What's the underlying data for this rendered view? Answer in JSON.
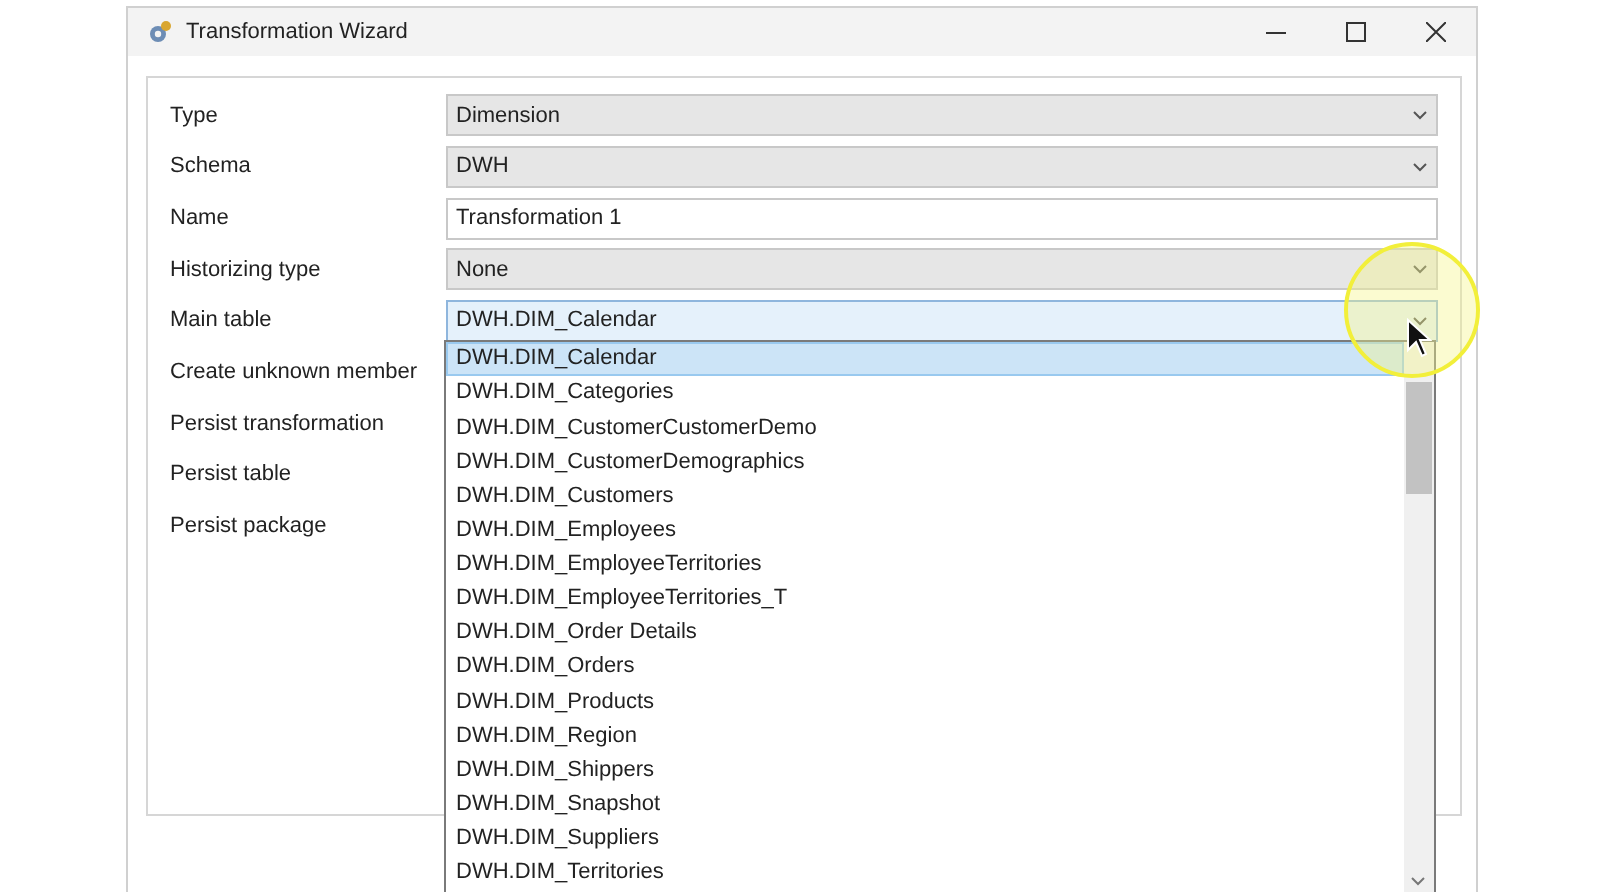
{
  "window": {
    "title": "Transformation Wizard"
  },
  "fields": [
    {
      "label": "Type",
      "kind": "combo",
      "value": "Dimension",
      "open": false
    },
    {
      "label": "Schema",
      "kind": "combo",
      "value": "DWH",
      "open": false
    },
    {
      "label": "Name",
      "kind": "text",
      "value": "Transformation 1"
    },
    {
      "label": "Historizing type",
      "kind": "combo",
      "value": "None",
      "open": false
    },
    {
      "label": "Main table",
      "kind": "combo",
      "value": "DWH.DIM_Calendar",
      "open": true
    },
    {
      "label": "Create unknown member",
      "kind": "check"
    },
    {
      "label": "Persist transformation",
      "kind": "check"
    },
    {
      "label": "Persist table",
      "kind": "check"
    },
    {
      "label": "Persist package",
      "kind": "check"
    }
  ],
  "dropdown": {
    "items": [
      {
        "label": "DWH.DIM_Calendar",
        "selected": true
      },
      {
        "label": "DWH.DIM_Categories",
        "selected": false
      },
      {
        "label": "DWH.DIM_CustomerCustomerDemo",
        "selected": false
      },
      {
        "label": "DWH.DIM_CustomerDemographics",
        "selected": false
      },
      {
        "label": "DWH.DIM_Customers",
        "selected": false
      },
      {
        "label": "DWH.DIM_Employees",
        "selected": false
      },
      {
        "label": "DWH.DIM_EmployeeTerritories",
        "selected": false
      },
      {
        "label": "DWH.DIM_EmployeeTerritories_T",
        "selected": false
      },
      {
        "label": "DWH.DIM_Order Details",
        "selected": false
      },
      {
        "label": "DWH.DIM_Orders",
        "selected": false
      },
      {
        "label": "DWH.DIM_Products",
        "selected": false
      },
      {
        "label": "DWH.DIM_Region",
        "selected": false
      },
      {
        "label": "DWH.DIM_Shippers",
        "selected": false
      },
      {
        "label": "DWH.DIM_Snapshot",
        "selected": false
      },
      {
        "label": "DWH.DIM_Suppliers",
        "selected": false
      },
      {
        "label": "DWH.DIM_Territories",
        "selected": false
      }
    ]
  }
}
